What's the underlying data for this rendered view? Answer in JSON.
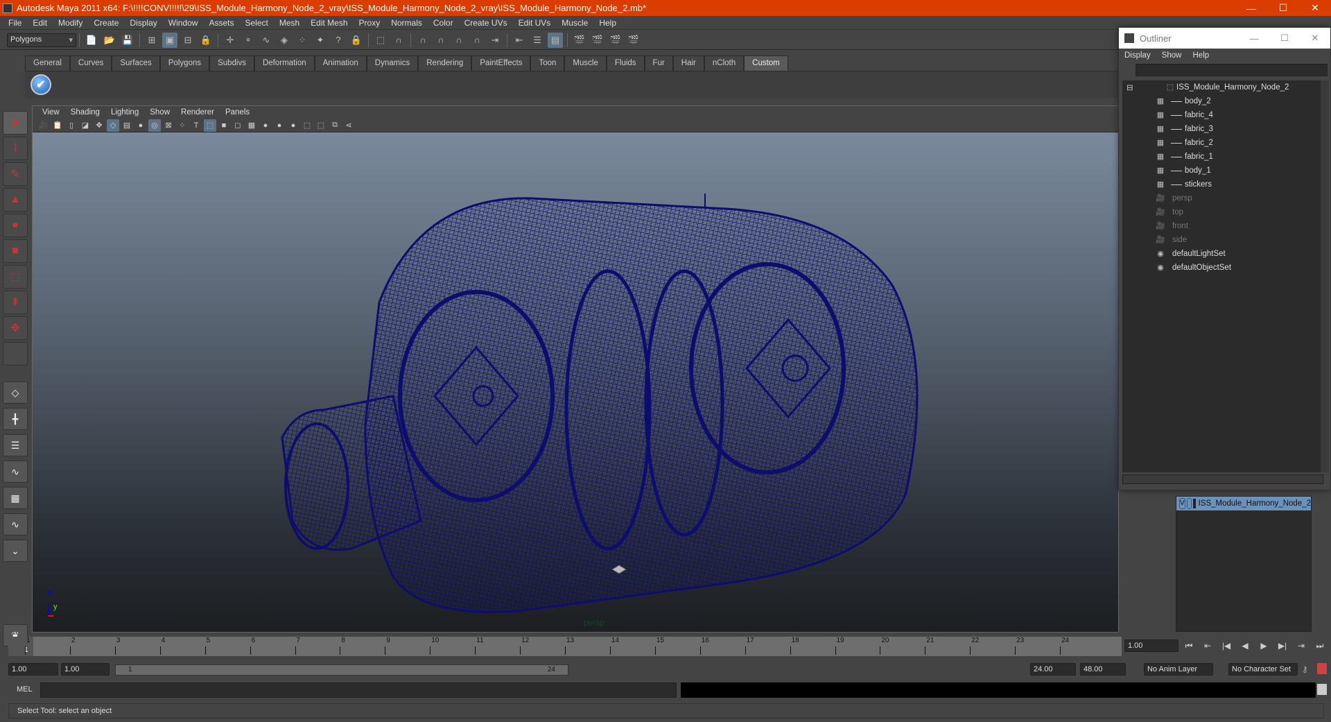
{
  "window": {
    "title": "Autodesk Maya 2011 x64: F:\\!!!!CONV!!!!!\\29\\ISS_Module_Harmony_Node_2_vray\\ISS_Module_Harmony_Node_2_vray\\ISS_Module_Harmony_Node_2.mb*",
    "minimize": "—",
    "maximize": "☐",
    "close": "✕"
  },
  "menubar": [
    "File",
    "Edit",
    "Modify",
    "Create",
    "Display",
    "Window",
    "Assets",
    "Select",
    "Mesh",
    "Edit Mesh",
    "Proxy",
    "Normals",
    "Color",
    "Create UVs",
    "Edit UVs",
    "Muscle",
    "Help"
  ],
  "statusline": {
    "menuset": "Polygons",
    "icons": [
      "new-scene",
      "open-scene",
      "save-scene",
      "select-hierarchy",
      "select-object",
      "select-component",
      "lock-selection",
      "select-handles",
      "select-joints",
      "select-curves",
      "select-surfaces",
      "select-deformations",
      "select-dynamics",
      "select-rendering",
      "select-misc",
      "lock-icon",
      "highlight-selection",
      "snap-grid",
      "snap-curve",
      "snap-point",
      "snap-view-plane",
      "snap-live",
      "input-ops",
      "output-ops",
      "construction-history",
      "render-view",
      "render-frame",
      "ipr-render",
      "render-settings"
    ]
  },
  "shelf": {
    "tabs": [
      "General",
      "Curves",
      "Surfaces",
      "Polygons",
      "Subdivs",
      "Deformation",
      "Animation",
      "Dynamics",
      "Rendering",
      "PaintEffects",
      "Toon",
      "Muscle",
      "Fluids",
      "Fur",
      "Hair",
      "nCloth",
      "Custom"
    ],
    "active_tab": "Custom",
    "button_glyph": "✔"
  },
  "toolbox": {
    "tools": [
      {
        "name": "select-tool",
        "glyph": "➤",
        "active": true
      },
      {
        "name": "lasso-tool",
        "glyph": "⌇"
      },
      {
        "name": "paint-select-tool",
        "glyph": "✎"
      },
      {
        "name": "move-tool",
        "glyph": "▲"
      },
      {
        "name": "rotate-tool",
        "glyph": "●"
      },
      {
        "name": "scale-tool",
        "glyph": "■"
      },
      {
        "name": "universal-manipulator",
        "glyph": "⬚"
      },
      {
        "name": "soft-modification-tool",
        "glyph": "⇞"
      },
      {
        "name": "show-manipulator-tool",
        "glyph": "✥"
      },
      {
        "name": "last-tool",
        "glyph": ""
      }
    ],
    "layouts": [
      {
        "name": "single-perspective-layout",
        "glyph": "◇"
      },
      {
        "name": "four-view-layout",
        "glyph": "╋"
      },
      {
        "name": "persp-outliner-layout",
        "glyph": "☰"
      },
      {
        "name": "persp-graph-layout",
        "glyph": "∿"
      },
      {
        "name": "hypershade-persp-layout",
        "glyph": "▦"
      },
      {
        "name": "persp-graph-hypergraph-layout",
        "glyph": "∿"
      },
      {
        "name": "more-layouts",
        "glyph": "⌄"
      }
    ],
    "logo_glyph": "❦"
  },
  "viewport": {
    "menu": [
      "View",
      "Shading",
      "Lighting",
      "Show",
      "Renderer",
      "Panels"
    ],
    "camera_name": "persp",
    "axis": {
      "z": "z",
      "y": "y"
    },
    "wire_color": "#0d0d6e",
    "panel_icons": [
      "select-camera",
      "camera-attributes",
      "bookmarks",
      "image-plane",
      "two-d-pan-zoom",
      "grid",
      "film-gate",
      "resolution-gate",
      "gate-mask",
      "field-chart",
      "safe-action",
      "safe-title",
      "wireframe",
      "smooth-shade-all",
      "smooth-shade-selected",
      "textured",
      "use-all-lights",
      "shadows",
      "high-quality",
      "isolate-select",
      "xray",
      "xray-joints",
      "xray-components"
    ]
  },
  "outliner": {
    "title": "Outliner",
    "menu": [
      "Display",
      "Show",
      "Help"
    ],
    "items": [
      {
        "label": "ISS_Module_Harmony_Node_2",
        "type": "group",
        "level": 0,
        "dim": false
      },
      {
        "label": "body_2",
        "type": "mesh",
        "level": 1,
        "dim": false
      },
      {
        "label": "fabric_4",
        "type": "mesh",
        "level": 1,
        "dim": false
      },
      {
        "label": "fabric_3",
        "type": "mesh",
        "level": 1,
        "dim": false
      },
      {
        "label": "fabric_2",
        "type": "mesh",
        "level": 1,
        "dim": false
      },
      {
        "label": "fabric_1",
        "type": "mesh",
        "level": 1,
        "dim": false
      },
      {
        "label": "body_1",
        "type": "mesh",
        "level": 1,
        "dim": false
      },
      {
        "label": "stickers",
        "type": "mesh",
        "level": 1,
        "dim": false
      },
      {
        "label": "persp",
        "type": "camera",
        "level": 0,
        "dim": true
      },
      {
        "label": "top",
        "type": "camera",
        "level": 0,
        "dim": true
      },
      {
        "label": "front",
        "type": "camera",
        "level": 0,
        "dim": true
      },
      {
        "label": "side",
        "type": "camera",
        "level": 0,
        "dim": true
      },
      {
        "label": "defaultLightSet",
        "type": "set",
        "level": 0,
        "dim": false
      },
      {
        "label": "defaultObjectSet",
        "type": "set",
        "level": 0,
        "dim": false
      }
    ]
  },
  "layers": {
    "rows": [
      {
        "visible": "V",
        "name": "ISS_Module_Harmony_Node_2"
      }
    ]
  },
  "timeslider": {
    "ticks": [
      "1",
      "2",
      "3",
      "4",
      "5",
      "6",
      "7",
      "8",
      "9",
      "10",
      "11",
      "12",
      "13",
      "14",
      "15",
      "16",
      "17",
      "18",
      "19",
      "20",
      "21",
      "22",
      "23",
      "24"
    ],
    "current_frame": "1",
    "current_time_field": "1.00"
  },
  "range": {
    "start_time": "1.00",
    "playback_start": "1.00",
    "range_start": "1",
    "range_end": "24",
    "playback_end": "24.00",
    "end_time": "48.00",
    "anim_layer": "No Anim Layer",
    "character_set": "No Character Set"
  },
  "playback": [
    "⏮",
    "⇤",
    "|◀",
    "◀",
    "▶",
    "▶|",
    "⇥",
    "⏭"
  ],
  "mel": {
    "label": "MEL"
  },
  "helpline": "Select Tool: select an object"
}
